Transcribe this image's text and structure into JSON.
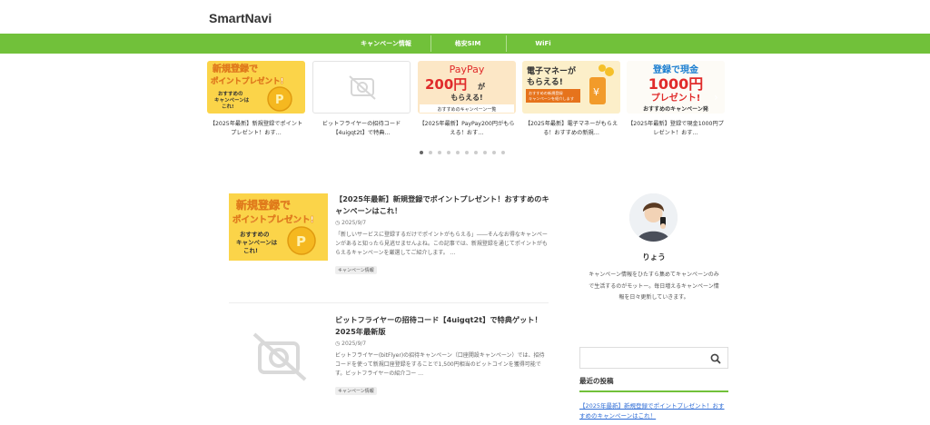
{
  "site": {
    "title": "SmartNavi"
  },
  "nav": {
    "items": [
      "キャンペーン情報",
      "格安SIM",
      "WiFi"
    ]
  },
  "carousel": {
    "cards": [
      {
        "title": "【2025年最新】新規登録でポイントプレゼント！おす…",
        "thumb": "yellow",
        "overlay": [
          "新規登録で",
          "ポイントプレゼント!",
          "おすすめの",
          "キャンペーンは",
          "これ!"
        ]
      },
      {
        "title": "ビットフライヤーの招待コード【4uigqt2t】で特典…",
        "thumb": "noimage"
      },
      {
        "title": "【2025年最新】PayPay200円がもらえる！おす…",
        "thumb": "paypay",
        "overlay": [
          "PayPay",
          "200円",
          "が",
          "もらえる!",
          "おすすめのキャンペーン一覧"
        ]
      },
      {
        "title": "【2025年最新】電子マネーがもらえる！おすすめの新規…",
        "thumb": "emoney",
        "overlay": [
          "電子マネーが",
          "もらえる!",
          "おすすめの新規登録",
          "キャンペーンを紹介します"
        ]
      },
      {
        "title": "【2025年最新】登録で現金1000円プレゼント！おす…",
        "thumb": "cash",
        "overlay": [
          "登録で現金",
          "1000円",
          "プレゼント!",
          "おすすめのキャンペーン発"
        ]
      }
    ],
    "dot_count": 10,
    "active_dot": 0
  },
  "posts": [
    {
      "title": "【2025年最新】新規登録でポイントプレゼント！おすすめのキャンペーンはこれ！",
      "date": "2025/9/7",
      "excerpt": "「新しいサービスに登録するだけでポイントがもらえる」――そんなお得なキャンペーンがあると知ったら見逃せませんよね。この記事では、新規登録を通じてポイントがもらえるキャンペーンを厳選してご紹介します。 …",
      "tag": "キャンペーン情報",
      "thumb_overlay": [
        "新規登録で",
        "ポイントプレゼント!",
        "おすすめの",
        "キャンペーンは",
        "これ!"
      ]
    },
    {
      "title": "ビットフライヤーの招待コード【4uigqt2t】で特典ゲット！2025年最新版",
      "date": "2025/9/7",
      "excerpt": "ビットフライヤー(bitFlyer)の招待キャンペーン（口座開設キャンペーン）では、招待コードを使って新規口座登録をすることで1,500円相当のビットコインを獲得可能です。ビットフライヤーの紹介コー …",
      "tag": "キャンペーン情報"
    }
  ],
  "sidebar": {
    "author_name": "りょう",
    "author_desc": "キャンペーン情報をひたすら集めてキャンペーンのみで生活するのがモットー。毎日増えるキャンペーン情報を日々更新していきます。",
    "search_placeholder": "",
    "recent_title": "最近の投稿",
    "recent_link": "【2025年最新】新規登録でポイントプレゼント！おすすめのキャンペーンはこれ！"
  },
  "colors": {
    "brand_green": "#71c13a",
    "link_blue": "#2f6dd6",
    "coin_yellow": "#fbd449"
  }
}
